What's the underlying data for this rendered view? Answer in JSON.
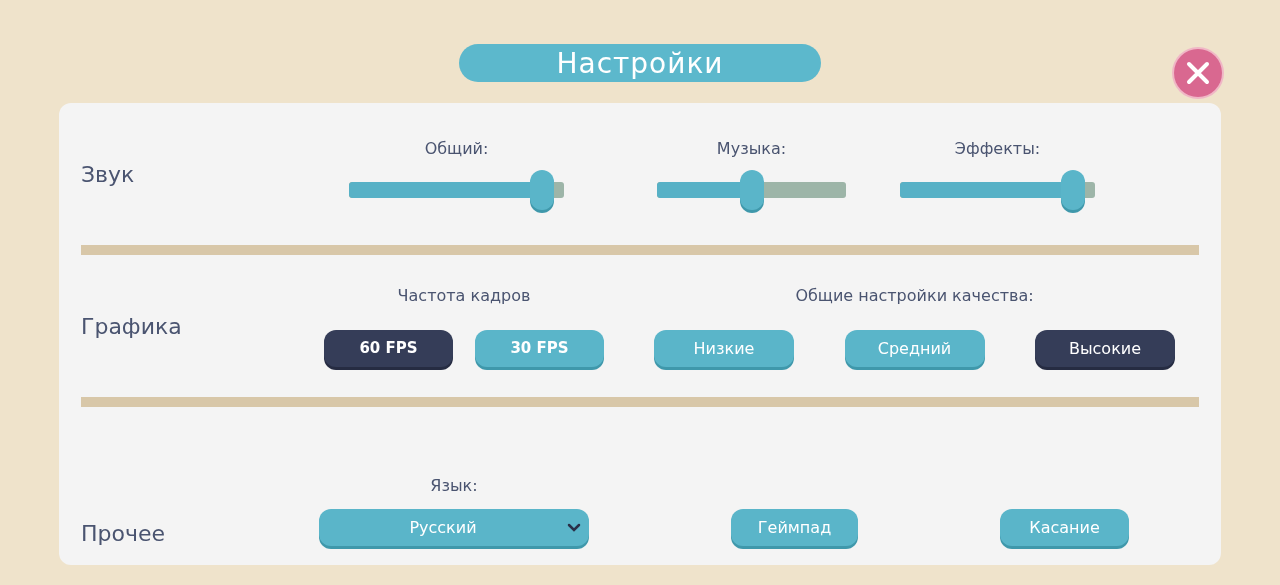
{
  "title": "Настройки",
  "sound": {
    "label": "Звук",
    "sliders": [
      {
        "label": "Общий:",
        "level": 0.95
      },
      {
        "label": "Музыка:",
        "level": 0.5
      },
      {
        "label": "Эффекты:",
        "level": 0.94
      }
    ]
  },
  "graphics": {
    "label": "Графика",
    "frame_rate": {
      "label": "Частота кадров",
      "options": [
        {
          "label": "60 FPS",
          "selected": true
        },
        {
          "label": "30 FPS",
          "selected": false
        }
      ]
    },
    "quality": {
      "label": "Общие настройки качества:",
      "options": [
        {
          "label": "Низкие",
          "selected": false
        },
        {
          "label": "Средний",
          "selected": false
        },
        {
          "label": "Высокие",
          "selected": true
        }
      ]
    }
  },
  "other": {
    "label": "Прочее",
    "language": {
      "label": "Язык:",
      "value": "Русский"
    },
    "buttons": [
      "Геймпад",
      "Касание"
    ]
  }
}
